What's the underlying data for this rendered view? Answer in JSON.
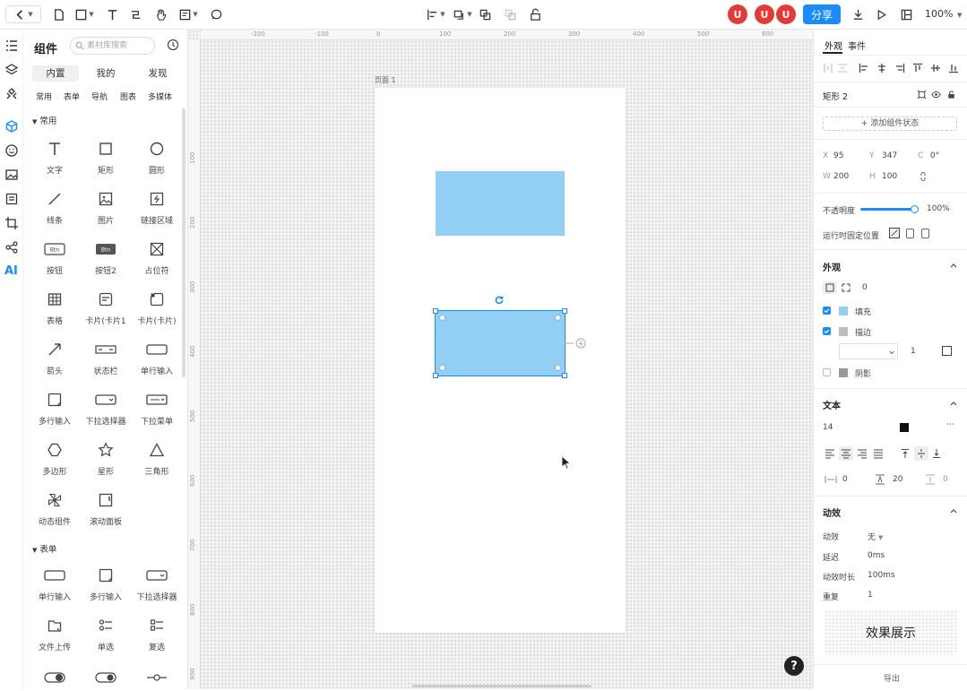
{
  "toolbar": {
    "share_label": "分享",
    "zoom": "100%",
    "avatar_letter": "U",
    "accent_color": "#1a8cff"
  },
  "left_panel": {
    "title": "组件",
    "search_placeholder": "素材库搜索",
    "tabs": [
      "内置",
      "我的",
      "发现"
    ],
    "subtabs": [
      "常用",
      "表单",
      "导航",
      "图表",
      "多媒体"
    ],
    "section_common": "常用",
    "section_form": "表单",
    "common_items": [
      {
        "label": "文字",
        "icon": "text-icon"
      },
      {
        "label": "矩形",
        "icon": "rectangle-icon"
      },
      {
        "label": "圆形",
        "icon": "circle-icon"
      },
      {
        "label": "线条",
        "icon": "line-icon"
      },
      {
        "label": "图片",
        "icon": "image-icon"
      },
      {
        "label": "链接区域",
        "icon": "hotspot-icon"
      },
      {
        "label": "按钮",
        "icon": "button-icon"
      },
      {
        "label": "按钮2",
        "icon": "button-filled-icon"
      },
      {
        "label": "占位符",
        "icon": "placeholder-icon"
      },
      {
        "label": "表格",
        "icon": "table-icon"
      },
      {
        "label": "卡片(卡片1",
        "icon": "card-icon"
      },
      {
        "label": "卡片(卡片)",
        "icon": "card-corner-icon"
      },
      {
        "label": "箭头",
        "icon": "arrow-icon"
      },
      {
        "label": "状态栏",
        "icon": "statusbar-icon"
      },
      {
        "label": "单行输入",
        "icon": "single-input-icon"
      },
      {
        "label": "多行输入",
        "icon": "multi-input-icon"
      },
      {
        "label": "下拉选择器",
        "icon": "dropdown-icon"
      },
      {
        "label": "下拉菜单",
        "icon": "dropdown-menu-icon"
      },
      {
        "label": "多边形",
        "icon": "polygon-icon"
      },
      {
        "label": "星形",
        "icon": "star-icon"
      },
      {
        "label": "三角形",
        "icon": "triangle-icon"
      },
      {
        "label": "动态组件",
        "icon": "dynamic-component-icon"
      },
      {
        "label": "滚动面板",
        "icon": "scroll-panel-icon"
      }
    ],
    "form_items": [
      {
        "label": "单行输入",
        "icon": "single-input-icon"
      },
      {
        "label": "多行输入",
        "icon": "multi-input-icon"
      },
      {
        "label": "下拉选择器",
        "icon": "dropdown-icon"
      },
      {
        "label": "文件上传",
        "icon": "upload-icon"
      },
      {
        "label": "单选",
        "icon": "radio-list-icon"
      },
      {
        "label": "复选",
        "icon": "checkbox-list-icon"
      }
    ]
  },
  "canvas": {
    "page_label": "页面 1",
    "ruler_top": [
      "-200",
      "-100",
      "0",
      "100",
      "200",
      "300",
      "400",
      "500",
      "600"
    ],
    "ruler_left": [
      "100",
      "200",
      "300",
      "400",
      "500",
      "600",
      "700",
      "800",
      "900"
    ],
    "help": "?"
  },
  "right_panel": {
    "tabs": [
      "外观",
      "事件"
    ],
    "element_name": "矩形 2",
    "add_state": "+ 添加组件状态",
    "x_label": "X",
    "x_value": "95",
    "y_label": "Y",
    "y_value": "347",
    "r_label": "C",
    "r_value": "0°",
    "w_label": "W",
    "w_value": "200",
    "h_label": "H",
    "h_value": "100",
    "opacity_label": "不透明度",
    "opacity_value": "100%",
    "fixed_label": "运行时固定位置",
    "appearance_title": "外观",
    "radius_value": "0",
    "fill_label": "填充",
    "fill_color": "#93cef5",
    "stroke_label": "描边",
    "stroke_color": "#bdbdbd",
    "stroke_width": "1",
    "shadow_label": "阴影",
    "shadow_color": "#999999",
    "text_title": "文本",
    "font_size": "14",
    "text_color": "#111111",
    "letter_spacing": "0",
    "line_height": "20",
    "para_spacing": "0",
    "anim_title": "动效",
    "anim_label": "动效",
    "anim_value": "无",
    "delay_label": "延迟",
    "delay_value": "0ms",
    "duration_label": "动效时长",
    "duration_value": "100ms",
    "repeat_label": "重复",
    "repeat_value": "1",
    "effect_button": "效果展示",
    "footer": "导出"
  }
}
